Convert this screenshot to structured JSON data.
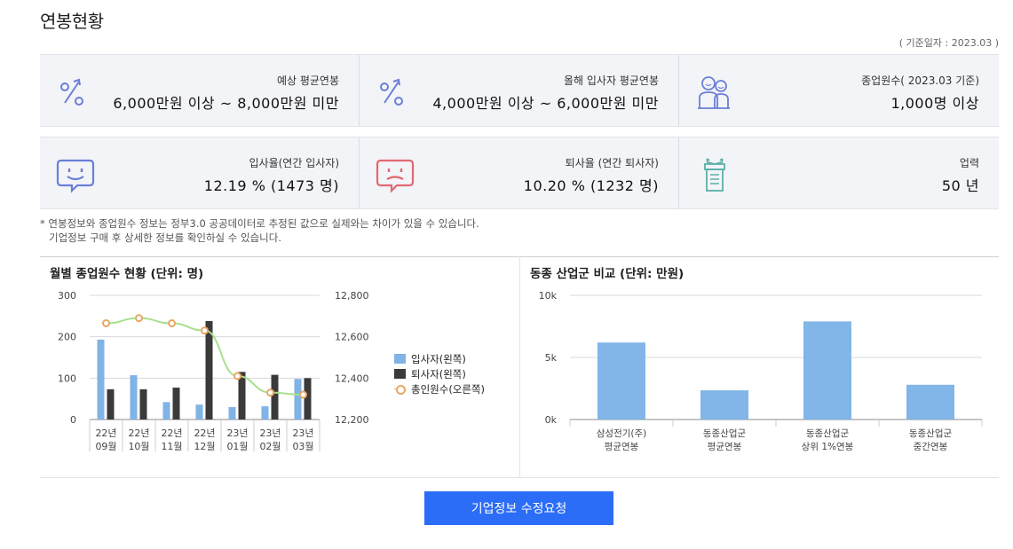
{
  "page": {
    "title": "연봉현황",
    "reference_date": "( 기준일자 : 2023.03 )"
  },
  "stats": [
    {
      "label": "예상 평균연봉",
      "value": "6,000만원 이상 ~ 8,000만원 미만",
      "icon": "percent-arrow-icon"
    },
    {
      "label": "올해 입사자 평균연봉",
      "value": "4,000만원 이상 ~ 6,000만원 미만",
      "icon": "percent-arrow-icon"
    },
    {
      "label": "종업원수( 2023.03 기준)",
      "value": "1,000명 이상",
      "icon": "people-icon"
    },
    {
      "label": "입사율(연간 입사자)",
      "value": "12.19 % (1473 명)",
      "icon": "smile-chat-icon"
    },
    {
      "label": "퇴사율 (연간 퇴사자)",
      "value": "10.20 % (1232 명)",
      "icon": "sad-chat-icon"
    },
    {
      "label": "업력",
      "value": "50 년",
      "icon": "gift-icon"
    }
  ],
  "footnote": {
    "line1": "* 연봉정보와 종업원수 정보는 정부3.0 공공데이터로 추정된 값으로 실제와는 차이가 있을 수 있습니다.",
    "line2": "기업정보 구매 후 상세한 정보를 확인하실 수 있습니다."
  },
  "colors": {
    "hire_bar": "#80b3e6",
    "quit_bar": "#3a3a3a",
    "total_line": "#a8e08c",
    "total_marker": "#e8a766",
    "compare_bar": "#82b5e8",
    "button": "#2b6df6",
    "icon_blue": "#6a7fd6",
    "icon_red": "#e06a70"
  },
  "chart_data": [
    {
      "type": "bar",
      "title": "월별 종업원수 현황 (단위: 명)",
      "categories": [
        [
          "22년",
          "09월"
        ],
        [
          "22년",
          "10월"
        ],
        [
          "22년",
          "11월"
        ],
        [
          "22년",
          "12월"
        ],
        [
          "23년",
          "01월"
        ],
        [
          "23년",
          "02월"
        ],
        [
          "23년",
          "03월"
        ]
      ],
      "y_left_ticks": [
        "300",
        "200",
        "100",
        "0"
      ],
      "y_right_ticks": [
        "12,800",
        "12,600",
        "12,400",
        "12,200"
      ],
      "ylim_left": [
        0,
        300
      ],
      "ylim_right": [
        12200,
        12800
      ],
      "series": [
        {
          "name": "입사자(왼쪽)",
          "type": "bar",
          "axis": "left",
          "values": [
            193,
            107,
            42,
            36,
            30,
            32,
            98
          ]
        },
        {
          "name": "퇴사자(왼쪽)",
          "type": "bar",
          "axis": "left",
          "values": [
            73,
            73,
            77,
            238,
            115,
            108,
            100
          ]
        },
        {
          "name": "총인원수(오른쪽)",
          "type": "line",
          "axis": "right",
          "values": [
            12665,
            12690,
            12665,
            12630,
            12410,
            12330,
            12320
          ]
        }
      ],
      "grid": true,
      "legend": "right"
    },
    {
      "type": "bar",
      "title": "동종 산업군 비교 (단위: 만원)",
      "categories": [
        [
          "삼성전기(주)",
          "평균연봉"
        ],
        [
          "동종산업군",
          "평균연봉"
        ],
        [
          "동종산업군",
          "상위 1%연봉"
        ],
        [
          "동종산업군",
          "중간연봉"
        ]
      ],
      "y_ticks": [
        "10k",
        "5k",
        "0k"
      ],
      "ylim": [
        0,
        10000
      ],
      "values": [
        6200,
        2350,
        7900,
        2800
      ],
      "grid": true
    }
  ],
  "button": {
    "label": "기업정보 수정요청"
  }
}
